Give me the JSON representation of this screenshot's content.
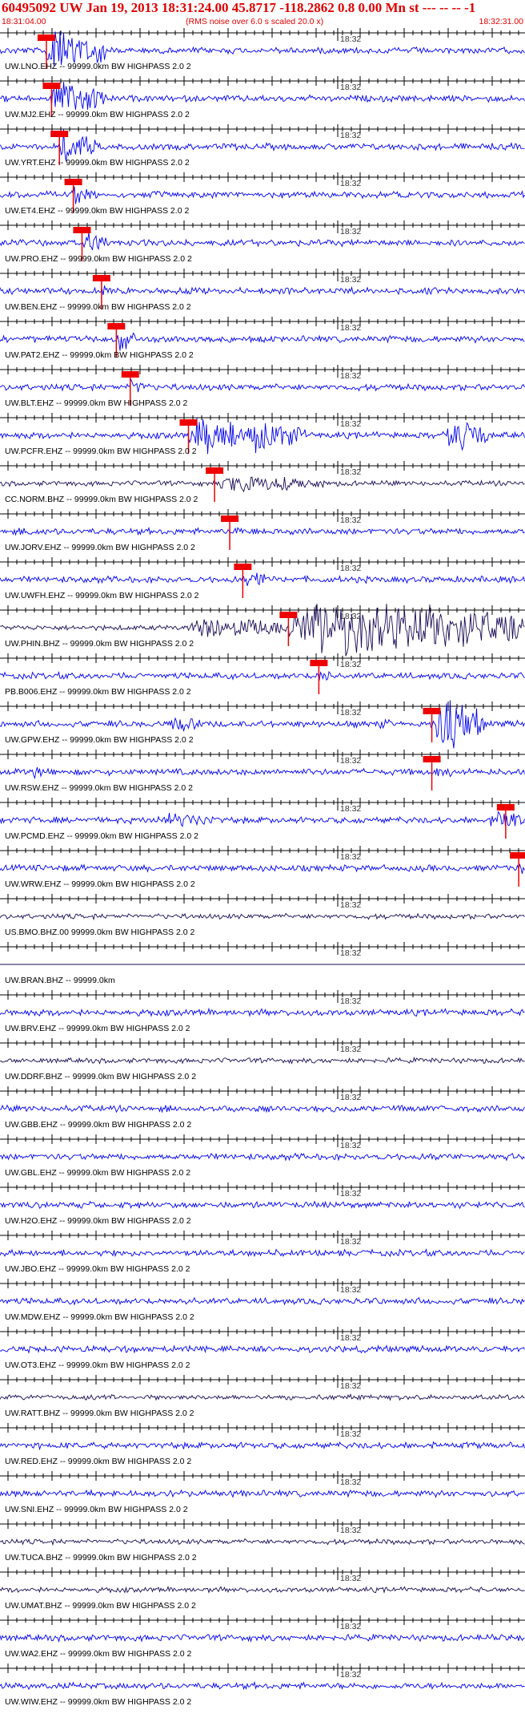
{
  "header": {
    "title": "60495092 UW Jan 19, 2013 18:31:24.00   45.8717 -118.2862  0.8 0.00 Mn st --- -- --  -1",
    "time_start": "18:31:04.00",
    "rms_note": "(RMS noise over 6.0 s scaled 20.0 x)",
    "time_end": "18:32:31.00"
  },
  "chart_data": {
    "type": "line",
    "title": "60495092 UW Jan 19, 2013 18:31:24.00   45.8717 -118.2862  0.8 0.00 Mn st --- -- --  -1",
    "xlabel": "",
    "ylabel": "",
    "x_range": [
      "18:31:04.00",
      "18:32:31.00"
    ],
    "minute_mark": "18:32",
    "colors": {
      "blue": "#0000ee",
      "dark": "#1a0a55",
      "pick": "#ee0000",
      "red_text": "#e00000"
    },
    "traces": [
      {
        "label": "UW.LNO.EHZ -- 99999.0km BW  HIGHPASS  2.0  2",
        "color": "blue",
        "pick": 1.03,
        "bursts": [
          [
            1.0,
            2.4,
            16
          ]
        ]
      },
      {
        "label": "UW.MJ2.EHZ -- 99999.0km BW  HIGHPASS  2.0  2",
        "color": "blue",
        "pick": 1.15,
        "bursts": [
          [
            1.1,
            2.4,
            12
          ]
        ]
      },
      {
        "label": "UW.YRT.EHZ -- 99999.0km BW  HIGHPASS  2.0  2",
        "color": "blue",
        "pick": 1.33,
        "bursts": [
          [
            1.3,
            2.2,
            12
          ]
        ]
      },
      {
        "label": "UW.ET4.EHZ -- 99999.0km BW  HIGHPASS  2.0  2",
        "color": "blue",
        "pick": 1.65,
        "bursts": [
          [
            1.6,
            2.2,
            8
          ]
        ]
      },
      {
        "label": "UW.PRO.EHZ -- 99999.0km BW  HIGHPASS  2.0  2",
        "color": "blue",
        "pick": 1.85,
        "bursts": [
          [
            1.85,
            2.5,
            8
          ]
        ]
      },
      {
        "label": "UW.BEN.EHZ -- 99999.0km BW  HIGHPASS  2.0  2",
        "color": "blue",
        "pick": 2.3,
        "bursts": [
          [
            2.3,
            2.5,
            5
          ]
        ]
      },
      {
        "label": "UW.PAT2.EHZ -- 99999.0km BW  HIGHPASS  2.0  2",
        "color": "blue",
        "pick": 2.64,
        "bursts": [
          [
            2.6,
            3.1,
            9
          ]
        ]
      },
      {
        "label": "UW.BLT.EHZ -- 99999.0km BW  HIGHPASS  2.0  2",
        "color": "blue",
        "pick": 2.96,
        "bursts": [
          [
            2.9,
            3.3,
            6
          ]
        ]
      },
      {
        "label": "UW.PCFR.EHZ -- 99999.0km BW  HIGHPASS  2.0  2",
        "color": "blue",
        "pick": 4.3,
        "bursts": [
          [
            4.3,
            5.5,
            14
          ],
          [
            5.5,
            7.0,
            12
          ],
          [
            10.2,
            11.2,
            12
          ]
        ]
      },
      {
        "label": "CC.NORM.BHZ -- 99999.0km BW  HIGHPASS  2.0  2",
        "color": "dark",
        "pick": 4.9,
        "bursts": [
          [
            4.9,
            7.5,
            6
          ]
        ]
      },
      {
        "label": "UW.JORV.EHZ -- 99999.0km BW  HIGHPASS  2.0  2",
        "color": "blue",
        "pick": 5.25,
        "bursts": [
          [
            0.6,
            1.2,
            3
          ],
          [
            5.2,
            6.5,
            2.5
          ]
        ]
      },
      {
        "label": "UW.UWFH.EHZ -- 99999.0km BW  HIGHPASS  2.0  2",
        "color": "blue",
        "pick": 5.55,
        "bursts": [
          [
            5.6,
            6.2,
            7
          ]
        ]
      },
      {
        "label": "UW.PHIN.BHZ -- 99999.0km BW  HIGHPASS  2.0  2",
        "color": "dark",
        "pick": 6.6,
        "bursts": [
          [
            4.3,
            6.6,
            8
          ],
          [
            6.6,
            12.0,
            20
          ]
        ]
      },
      {
        "label": "PB.B006.EHZ -- 99999.0km BW  HIGHPASS  2.0  2",
        "color": "blue",
        "pick": 7.3,
        "bursts": [
          [
            7.2,
            7.8,
            4
          ]
        ]
      },
      {
        "label": "UW.GPW.EHZ -- 99999.0km BW  HIGHPASS  2.0  2",
        "color": "blue",
        "pick": 9.9,
        "bursts": [
          [
            3.9,
            4.6,
            6
          ],
          [
            8.6,
            9.0,
            5
          ],
          [
            9.9,
            11.1,
            18
          ]
        ]
      },
      {
        "label": "UW.RSW.EHZ -- 99999.0km BW  HIGHPASS  2.0  2",
        "color": "blue",
        "pick": 9.9,
        "bursts": [
          [
            0.7,
            1.0,
            6
          ],
          [
            9.9,
            10.4,
            5
          ]
        ]
      },
      {
        "label": "UW.PCMD.EHZ -- 99999.0km BW  HIGHPASS  2.0  2",
        "color": "blue",
        "pick": 11.6,
        "bursts": [
          [
            3.6,
            5.0,
            5
          ],
          [
            11.2,
            12.0,
            7
          ]
        ]
      },
      {
        "label": "UW.WRW.EHZ -- 99999.0km BW  HIGHPASS  2.0  2",
        "color": "blue",
        "pick": 11.9,
        "bursts": [
          [
            11.9,
            12.0,
            10
          ]
        ]
      },
      {
        "label": "US.BMO.BHZ.00 99999.0km BW  HIGHPASS  2.0  2",
        "color": "dark",
        "pick": null,
        "bursts": []
      },
      {
        "label": "UW.BRAN.BHZ -- 99999.0km",
        "color": "dark",
        "pick": null,
        "bursts": [],
        "flat": true
      },
      {
        "label": "UW.BRV.EHZ -- 99999.0km BW  HIGHPASS  2.0  2",
        "color": "blue",
        "pick": null,
        "bursts": []
      },
      {
        "label": "UW.DDRF.BHZ -- 99999.0km BW  HIGHPASS  2.0  2",
        "color": "dark",
        "pick": null,
        "bursts": []
      },
      {
        "label": "UW.GBB.EHZ -- 99999.0km BW  HIGHPASS  2.0  2",
        "color": "blue",
        "pick": null,
        "bursts": []
      },
      {
        "label": "UW.GBL.EHZ -- 99999.0km BW  HIGHPASS  2.0  2",
        "color": "blue",
        "pick": null,
        "bursts": []
      },
      {
        "label": "UW.H2O.EHZ -- 99999.0km BW  HIGHPASS  2.0  2",
        "color": "blue",
        "pick": null,
        "bursts": []
      },
      {
        "label": "UW.JBO.EHZ -- 99999.0km BW  HIGHPASS  2.0  2",
        "color": "blue",
        "pick": null,
        "bursts": []
      },
      {
        "label": "UW.MDW.EHZ -- 99999.0km BW  HIGHPASS  2.0  2",
        "color": "blue",
        "pick": null,
        "bursts": []
      },
      {
        "label": "UW.OT3.EHZ -- 99999.0km BW  HIGHPASS  2.0  2",
        "color": "blue",
        "pick": null,
        "bursts": [
          [
            10.8,
            11.4,
            2
          ]
        ]
      },
      {
        "label": "UW.RATT.BHZ -- 99999.0km BW  HIGHPASS  2.0  2",
        "color": "dark",
        "pick": null,
        "bursts": []
      },
      {
        "label": "UW.RED.EHZ -- 99999.0km BW  HIGHPASS  2.0  2",
        "color": "blue",
        "pick": null,
        "bursts": []
      },
      {
        "label": "UW.SNI.EHZ -- 99999.0km BW  HIGHPASS  2.0  2",
        "color": "blue",
        "pick": null,
        "bursts": []
      },
      {
        "label": "UW.TUCA.BHZ -- 99999.0km BW  HIGHPASS  2.0  2",
        "color": "dark",
        "pick": null,
        "bursts": []
      },
      {
        "label": "UW.UMAT.BHZ -- 99999.0km BW  HIGHPASS  2.0  2",
        "color": "dark",
        "pick": null,
        "bursts": []
      },
      {
        "label": "UW.WA2.EHZ -- 99999.0km BW  HIGHPASS  2.0  2",
        "color": "blue",
        "pick": null,
        "bursts": [
          [
            11.4,
            12.0,
            2
          ]
        ]
      },
      {
        "label": "UW.WIW.EHZ -- 99999.0km BW  HIGHPASS  2.0  2",
        "color": "blue",
        "pick": null,
        "bursts": []
      }
    ]
  }
}
